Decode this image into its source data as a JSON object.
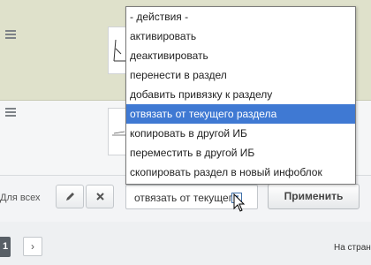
{
  "bulk_actions": {
    "for_all_label": "Для всех",
    "edit_icon": "pencil-icon",
    "delete_icon": "close-icon",
    "selected_action": "отвязать от текущего раздела",
    "apply_label": "Применить"
  },
  "dropdown": {
    "selected_index": 4,
    "options": [
      "- действия -",
      "активировать",
      "деактивировать",
      "перенести в раздел",
      "добавить привязку к разделу",
      "отвязать от текущего раздела",
      "копировать в другой ИБ",
      "переместить в другой ИБ",
      "скопировать раздел в новый инфоблок"
    ]
  },
  "pagination": {
    "current_page": "1",
    "next_label": "›",
    "per_page_label": "На странице"
  },
  "colors": {
    "selected_row_bg": "#dfe1cb",
    "option_highlight": "#3f79d3"
  }
}
